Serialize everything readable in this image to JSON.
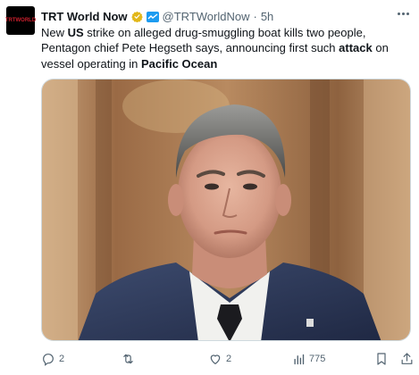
{
  "tweet": {
    "avatar_text": "TRTWORLD",
    "author_name": "TRT World Now",
    "handle": "@TRTWorldNow",
    "separator": "·",
    "time": "5h",
    "text": {
      "p1": "New ",
      "b1": "US",
      "p2": " strike on alleged drug-smuggling boat kills two people, Pentagon chief Pete Hegseth says, announcing first such ",
      "b2": "attack",
      "p3": " on vessel operating in ",
      "b3": "Pacific Ocean"
    }
  },
  "actions": {
    "replies": "2",
    "retweets": "",
    "likes": "2",
    "views": "775"
  },
  "colors": {
    "muted": "#536471",
    "verified_gold": "#e2b719",
    "affiliate_blue": "#1d9bf0",
    "brand_red": "#cc1f2d"
  },
  "icons": [
    "verified-gold-badge-icon",
    "affiliate-badge-icon",
    "more-options-icon",
    "reply-icon",
    "retweet-icon",
    "like-icon",
    "views-icon",
    "bookmark-icon",
    "share-icon"
  ]
}
